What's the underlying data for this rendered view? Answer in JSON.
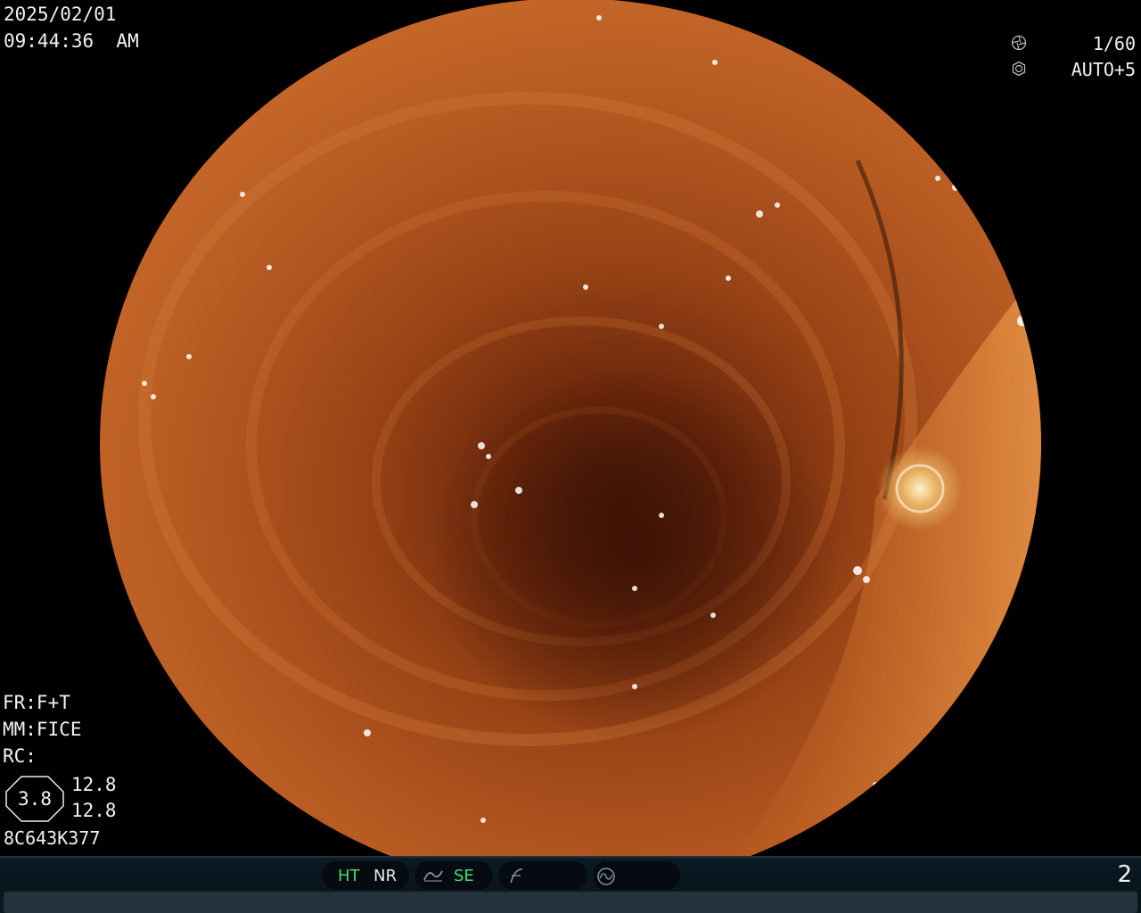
{
  "osd": {
    "date": "2025/02/01",
    "time": "09:44:36  AM",
    "shutter": "1/60",
    "iris": "AUTO+5",
    "shutter_icon": "aperture-icon",
    "iris_icon": "iris-icon",
    "fr": "FR:F+T",
    "mm": "MM:FICE",
    "rc": "RC:",
    "zoom": "3.8",
    "value_1": "12.8",
    "value_2": "12.8",
    "serial": "8C643K377"
  },
  "status_bar": {
    "ht": "HT",
    "nr": "NR",
    "se": "SE",
    "se_icon": "curve-icon",
    "f_icon": "f-curve-icon",
    "circle_icon": "wave-circle-icon",
    "page": "2"
  },
  "colors": {
    "background": "#000000",
    "active_mode": "#3ee26a",
    "tissue": "#b5531e"
  }
}
